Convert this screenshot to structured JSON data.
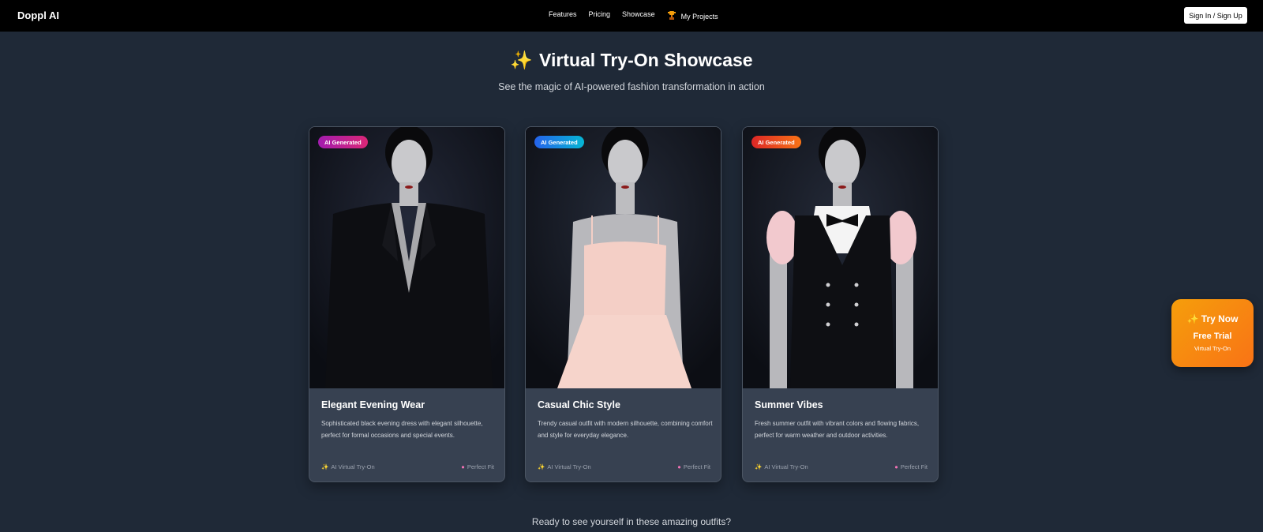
{
  "brand": "Doppl AI",
  "nav": {
    "features": "Features",
    "pricing": "Pricing",
    "showcase": "Showcase",
    "projects": "My Projects",
    "signin": "Sign In / Sign Up"
  },
  "hero": {
    "spark": "✨",
    "title": "Virtual Try-On Showcase",
    "subtitle": "See the magic of AI-powered fashion transformation in action"
  },
  "cards": [
    {
      "badge": "AI Generated",
      "badge_color": "#c026d3",
      "title": "Elegant Evening Wear",
      "desc": "Sophisticated black evening dress with elegant silhouette, perfect for formal occasions and special events.",
      "meta_left": "AI Virtual Try-On",
      "meta_right": "Perfect Fit"
    },
    {
      "badge": "AI Generated",
      "badge_color": "#0ea5e9",
      "title": "Casual Chic Style",
      "desc": "Trendy casual outfit with modern silhouette, combining comfort and style for everyday elegance.",
      "meta_left": "AI Virtual Try-On",
      "meta_right": "Perfect Fit"
    },
    {
      "badge": "AI Generated",
      "badge_color": "#ef4444",
      "title": "Summer Vibes",
      "desc": "Fresh summer outfit with vibrant colors and flowing fabrics, perfect for warm weather and outdoor activities.",
      "meta_left": "AI Virtual Try-On",
      "meta_right": "Perfect Fit"
    }
  ],
  "cta": "Ready to see yourself in these amazing outfits?",
  "floating": {
    "line1": "✨ Try Now",
    "line2": "Free Trial",
    "line3": "Virtual Try-On"
  }
}
